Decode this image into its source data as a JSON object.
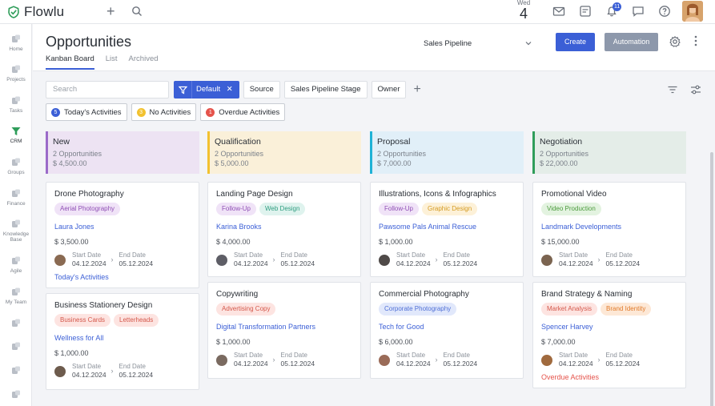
{
  "app": {
    "name": "Flowlu"
  },
  "topbar": {
    "date": {
      "weekday": "Wed",
      "day": "4"
    },
    "notifications_count": "11",
    "icons": [
      "plus-icon",
      "search-icon",
      "mail-icon",
      "notes-icon",
      "bell-icon",
      "chat-icon",
      "help-icon"
    ]
  },
  "sidebar": {
    "items": [
      {
        "label": "Home",
        "icon": "home-icon"
      },
      {
        "label": "Projects",
        "icon": "projects-icon"
      },
      {
        "label": "Tasks",
        "icon": "tasks-icon"
      },
      {
        "label": "CRM",
        "icon": "crm-icon",
        "active": true
      },
      {
        "label": "Groups",
        "icon": "groups-icon"
      },
      {
        "label": "Finance",
        "icon": "finance-icon"
      },
      {
        "label": "Knowledge Base",
        "icon": "knowledge-icon"
      },
      {
        "label": "Agile",
        "icon": "agile-icon"
      },
      {
        "label": "My Team",
        "icon": "team-icon"
      },
      {
        "label": "",
        "icon": "extra-icon"
      },
      {
        "label": "",
        "icon": "extra-icon"
      },
      {
        "label": "",
        "icon": "extra-icon"
      },
      {
        "label": "",
        "icon": "extra-icon"
      }
    ]
  },
  "header": {
    "title": "Opportunities",
    "tabs": [
      {
        "label": "Kanban Board",
        "active": true
      },
      {
        "label": "List"
      },
      {
        "label": "Archived"
      }
    ],
    "pipeline_select": "Sales Pipeline",
    "create_label": "Create",
    "automation_label": "Automation"
  },
  "filters": {
    "search_placeholder": "Search",
    "default_label": "Default",
    "chips": [
      "Source",
      "Sales Pipeline Stage",
      "Owner"
    ]
  },
  "activities": [
    {
      "count": "5",
      "label": "Today's Activities",
      "color": "#3b5fd6"
    },
    {
      "count": "3",
      "label": "No Activities",
      "color": "#f2c230"
    },
    {
      "count": "1",
      "label": "Overdue Activities",
      "color": "#e5534b"
    }
  ],
  "columns": [
    {
      "title": "New",
      "count": "2 Opportunities",
      "amount": "$ 4,500.00",
      "bg": "#ede3f3",
      "accent": "#9b6bc9",
      "cards": [
        {
          "title": "Drone Photography",
          "tags": [
            {
              "label": "Aerial Photography",
              "bg": "#f0e3f7",
              "fg": "#8f4fb5"
            }
          ],
          "company": "Laura Jones",
          "amount": "$ 3,500.00",
          "start_label": "Start Date",
          "start": "04.12.2024",
          "end_label": "End Date",
          "end": "05.12.2024",
          "activity": "Today's Activities",
          "activity_color": "#3b5fd6",
          "avatar": "#8a6a52"
        },
        {
          "title": "Business Stationery Design",
          "tags": [
            {
              "label": "Business Cards",
              "bg": "#fde4e1",
              "fg": "#d4584b"
            },
            {
              "label": "Letterheads",
              "bg": "#fde4e1",
              "fg": "#d4584b"
            }
          ],
          "company": "Wellness for All",
          "amount": "$ 1,000.00",
          "start_label": "Start Date",
          "start": "04.12.2024",
          "end_label": "End Date",
          "end": "05.12.2024",
          "activity": "",
          "activity_color": "",
          "avatar": "#6d5b4d"
        }
      ]
    },
    {
      "title": "Qualification",
      "count": "2 Opportunities",
      "amount": "$ 5,000.00",
      "bg": "#faf0d9",
      "accent": "#f2c230",
      "cards": [
        {
          "title": "Landing Page Design",
          "tags": [
            {
              "label": "Follow-Up",
              "bg": "#f0e3f7",
              "fg": "#8f4fb5"
            },
            {
              "label": "Web Design",
              "bg": "#dff3ee",
              "fg": "#2f9d80"
            }
          ],
          "company": "Karina Brooks",
          "amount": "$ 4,000.00",
          "start_label": "Start Date",
          "start": "04.12.2024",
          "end_label": "End Date",
          "end": "05.12.2024",
          "activity": "",
          "activity_color": "",
          "avatar": "#5e5e66"
        },
        {
          "title": "Copywriting",
          "tags": [
            {
              "label": "Advertising Copy",
              "bg": "#fde4e1",
              "fg": "#d4584b"
            }
          ],
          "company": "Digital Transformation Partners",
          "amount": "$ 1,000.00",
          "start_label": "Start Date",
          "start": "04.12.2024",
          "end_label": "End Date",
          "end": "05.12.2024",
          "activity": "",
          "activity_color": "",
          "avatar": "#7a6a60"
        }
      ]
    },
    {
      "title": "Proposal",
      "count": "2 Opportunities",
      "amount": "$ 7,000.00",
      "bg": "#e1eff8",
      "accent": "#1fb2d6",
      "cards": [
        {
          "title": "Illustrations, Icons & Infographics",
          "tags": [
            {
              "label": "Follow-Up",
              "bg": "#f0e3f7",
              "fg": "#8f4fb5"
            },
            {
              "label": "Graphic Design",
              "bg": "#fdf1d8",
              "fg": "#d49a20"
            }
          ],
          "company": "Pawsome Pals Animal Rescue",
          "amount": "$ 1,000.00",
          "start_label": "Start Date",
          "start": "04.12.2024",
          "end_label": "End Date",
          "end": "05.12.2024",
          "activity": "",
          "activity_color": "",
          "avatar": "#4f4a48"
        },
        {
          "title": "Commercial Photography",
          "tags": [
            {
              "label": "Corporate Photography",
              "bg": "#e1e8fb",
              "fg": "#4f6fd6"
            }
          ],
          "company": "Tech for Good",
          "amount": "$ 6,000.00",
          "start_label": "Start Date",
          "start": "04.12.2024",
          "end_label": "End Date",
          "end": "05.12.2024",
          "activity": "",
          "activity_color": "",
          "avatar": "#9a6b58"
        }
      ]
    },
    {
      "title": "Negotiation",
      "count": "2 Opportunities",
      "amount": "$ 22,000.00",
      "bg": "#e4ede8",
      "accent": "#2f9d5a",
      "cards": [
        {
          "title": "Promotional Video",
          "tags": [
            {
              "label": "Video Production",
              "bg": "#e3f3e0",
              "fg": "#4b9a3c"
            }
          ],
          "company": "Landmark Developments",
          "amount": "$ 15,000.00",
          "start_label": "Start Date",
          "start": "04.12.2024",
          "end_label": "End Date",
          "end": "05.12.2024",
          "activity": "",
          "activity_color": "",
          "avatar": "#7b6450"
        },
        {
          "title": "Brand Strategy & Naming",
          "tags": [
            {
              "label": "Market Analysis",
              "bg": "#fde4e1",
              "fg": "#d4584b"
            },
            {
              "label": "Brand Identity",
              "bg": "#fde8d6",
              "fg": "#e07a2a"
            }
          ],
          "company": "Spencer Harvey",
          "amount": "$ 7,000.00",
          "start_label": "Start Date",
          "start": "04.12.2024",
          "end_label": "End Date",
          "end": "05.12.2024",
          "activity": "Overdue Activities",
          "activity_color": "#e5534b",
          "avatar": "#a06a3e"
        }
      ]
    }
  ]
}
